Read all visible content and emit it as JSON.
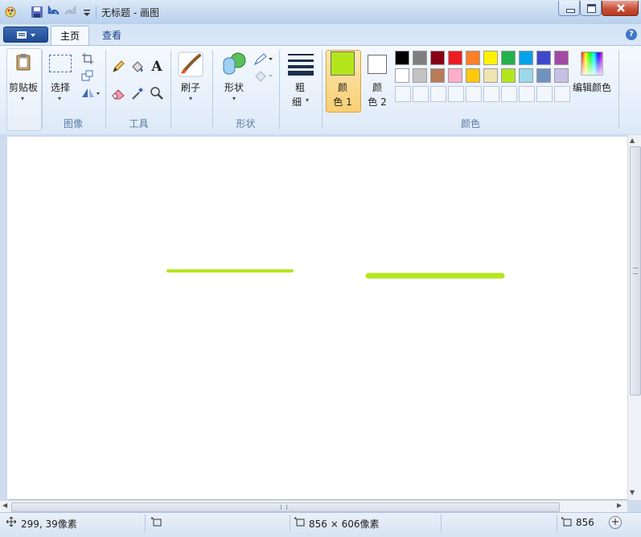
{
  "window": {
    "title": "无标题 - 画图"
  },
  "tabs": [
    {
      "label": "主页"
    },
    {
      "label": "查看"
    }
  ],
  "ribbon": {
    "clipboard": {
      "label": "剪贴板"
    },
    "image": {
      "select_label": "选择",
      "group_label": "图像"
    },
    "tools": {
      "group_label": "工具"
    },
    "brushes": {
      "label": "刷子"
    },
    "shapes": {
      "label": "形状",
      "group_label": "形状"
    },
    "size": {
      "label_line1": "粗",
      "label_line2": "细"
    },
    "colors": {
      "color1_line1": "颜",
      "color1_line2": "色 1",
      "color2_line1": "颜",
      "color2_line2": "色 2",
      "edit_label": "编辑颜色",
      "group_label": "颜色",
      "color1_value": "#b5e61d",
      "color2_value": "#ffffff",
      "palette_row1": [
        "#000000",
        "#7f7f7f",
        "#880015",
        "#ed1c24",
        "#ff7f27",
        "#fff200",
        "#22b14c",
        "#00a2e8",
        "#3f48cc",
        "#a349a4"
      ],
      "palette_row2": [
        "#ffffff",
        "#c3c3c3",
        "#b97a57",
        "#ffaec9",
        "#ffc90e",
        "#efe4b0",
        "#b5e61d",
        "#99d9ea",
        "#7092be",
        "#c8bfe7"
      ]
    }
  },
  "canvas": {
    "stroke_color": "#b5e61d"
  },
  "statusbar": {
    "cursor_position": "299, 39像素",
    "canvas_size": "856 × 606像素",
    "zoom_fragment": "856"
  }
}
